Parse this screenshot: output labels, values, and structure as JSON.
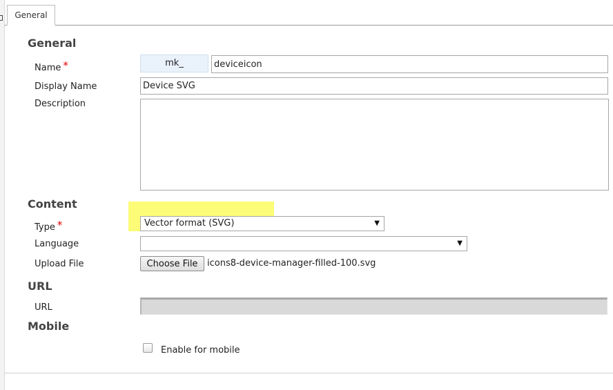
{
  "tabs": [
    {
      "label": "General",
      "active": true
    }
  ],
  "sections": {
    "general": "General",
    "content": "Content",
    "url": "URL",
    "mobile": "Mobile"
  },
  "fields": {
    "name": {
      "label": "Name",
      "required_mark": "*",
      "prefix": "mk_",
      "value": "deviceicon"
    },
    "display_name": {
      "label": "Display Name",
      "value": "Device SVG"
    },
    "description": {
      "label": "Description",
      "value": ""
    },
    "type": {
      "label": "Type",
      "required_mark": "*",
      "selected": "Vector format (SVG)"
    },
    "language": {
      "label": "Language",
      "selected": ""
    },
    "upload_file": {
      "label": "Upload File",
      "button_label": "Choose File",
      "file_name": "icons8-device-manager-filled-100.svg"
    },
    "url": {
      "label": "URL",
      "value": ""
    },
    "mobile": {
      "checkbox_label": "Enable for mobile",
      "checked": false
    }
  },
  "icons": {
    "dropdown": "chevron-down-icon"
  },
  "colors": {
    "required": "#e00000",
    "highlight": "#fbfb5f",
    "prefix_bg": "#e9f1fb"
  }
}
